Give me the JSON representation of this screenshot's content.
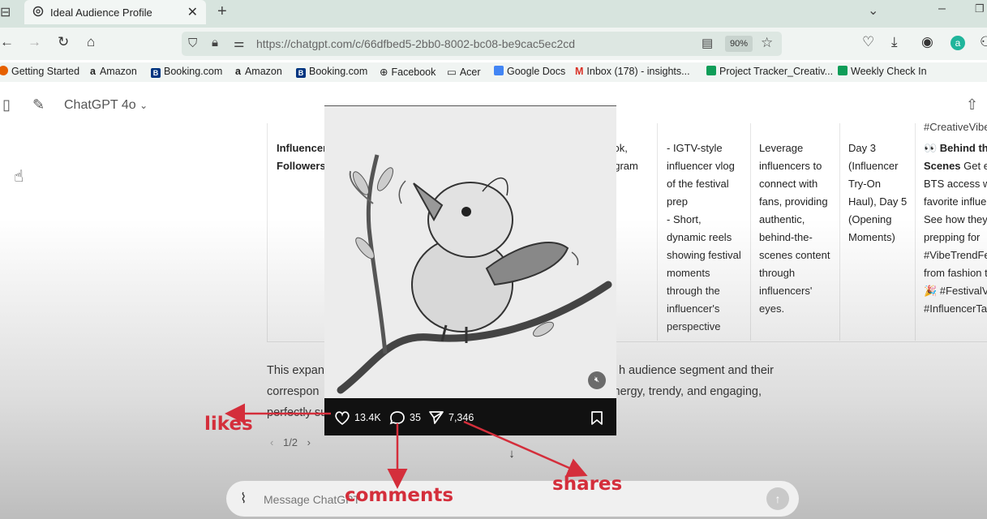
{
  "browser": {
    "tab_title": "Ideal Audience Profile",
    "url": "https://chatgpt.com/c/66dfbed5-2bb0-8002-bc08-be9cac5ec2cd",
    "zoom": "90%",
    "bookmarks": [
      {
        "label": "Getting Started",
        "color": "#e66000"
      },
      {
        "label": "Amazon",
        "color": "#111111"
      },
      {
        "label": "Booking.com",
        "color": "#003580"
      },
      {
        "label": "Amazon",
        "color": "#111111"
      },
      {
        "label": "Booking.com",
        "color": "#003580"
      },
      {
        "label": "Facebook",
        "color": "#555555"
      },
      {
        "label": "Acer",
        "color": "#555555"
      },
      {
        "label": "Google Docs",
        "color": "#4285f4"
      },
      {
        "label": "Inbox (178) - insights...",
        "color": "#d93025"
      },
      {
        "label": "Project Tracker_Creativ...",
        "color": "#0f9d58"
      },
      {
        "label": "Weekly Check In",
        "color": "#0f9d58"
      }
    ]
  },
  "app": {
    "model_name": "ChatGPT 4o",
    "composer_placeholder": "Message ChatGPT"
  },
  "table": {
    "col1": [
      "Influencer",
      "Followers"
    ],
    "col2": [
      "Tok,",
      "agram"
    ],
    "col3": [
      "- IGTV-style",
      "influencer vlog",
      "of the festival",
      "prep",
      "- Short,",
      "dynamic reels",
      "showing festival",
      "moments",
      "through the",
      "influencer's",
      "perspective"
    ],
    "col4": [
      "Leverage",
      "influencers to",
      "connect with",
      "fans, providing",
      "authentic,",
      "behind-the-",
      "scenes content",
      "through",
      "influencers'",
      "eyes."
    ],
    "col5": [
      "Day 3",
      "(Influencer",
      "Try-On",
      "Haul), Day 5",
      "(Opening",
      "Moments)"
    ],
    "col6_top": "#CreativeVibe",
    "col6_bold": "👀 Behind th",
    "col6_bold2": "Scenes",
    "col6_rest": [
      " Get ex",
      "BTS access wit",
      "favorite influe",
      "See how they'",
      "prepping for",
      "#VibeTrendFe",
      "from fashion t",
      "🎉 #FestivalV",
      "#InfluencerTal"
    ]
  },
  "paragraph": {
    "line1_left": "This expan",
    "line1_right": "h audience segment and their",
    "line2_left": "correspon",
    "line2_right": "nergy, trendy, and engaging,",
    "line3_left": "perfectly su"
  },
  "pager": "1/2",
  "video": {
    "likes": "13.4K",
    "comments": "35",
    "shares": "7,346"
  },
  "annotations": {
    "likes": "likes",
    "comments": "comments",
    "shares": "shares"
  },
  "colors": {
    "annotation": "#d42e3b",
    "tab_strip": "#d7e4de"
  }
}
